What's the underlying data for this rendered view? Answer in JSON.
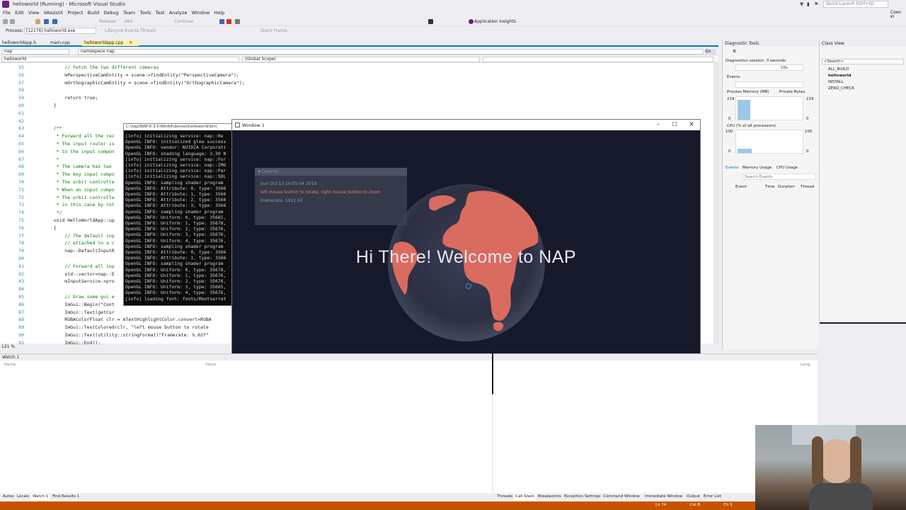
{
  "titlebar": {
    "title": "helloworld (Running) - Microsoft Visual Studio",
    "quick_launch": "Quick Launch (Ctrl+Q)",
    "user": "Coen Kl"
  },
  "menu": [
    "File",
    "Edit",
    "View",
    "VAssistX",
    "Project",
    "Build",
    "Debug",
    "Team",
    "Tools",
    "Test",
    "Analyze",
    "Window",
    "Help"
  ],
  "toolbar": {
    "config": "Release",
    "platform": "x64",
    "continue": "Continue",
    "insights": "Application Insights",
    "process_label": "Process:",
    "process_value": "[12176] helloworld.exe",
    "lifecycle": "Lifecycle Events",
    "thread": "Thread:",
    "stack_frame": "Stack Frame:"
  },
  "doc_tabs": [
    "helloworldapp.h",
    "main.cpp",
    "helloworldapp.cpp"
  ],
  "nav": {
    "project": "nap",
    "scope": "namespace nap",
    "file": "helloworld",
    "global": "(Global Scope)"
  },
  "editor": {
    "zoom": "121 %",
    "lines": [
      {
        "n": "55",
        "t": "        // Fetch the two different cameras",
        "c": "cm"
      },
      {
        "n": "56",
        "t": "        mPerspectiveCamEntity = scene->findEntity(\"PerspectiveCamera\");",
        "c": ""
      },
      {
        "n": "57",
        "t": "        mOrthographicCamEntity = scene->findEntity(\"OrthographicCamera\");",
        "c": ""
      },
      {
        "n": "58",
        "t": "",
        "c": ""
      },
      {
        "n": "59",
        "t": "        return true;",
        "c": ""
      },
      {
        "n": "60",
        "t": "    }",
        "c": ""
      },
      {
        "n": "61",
        "t": "",
        "c": ""
      },
      {
        "n": "62",
        "t": "",
        "c": ""
      },
      {
        "n": "63",
        "t": "    /**",
        "c": "cm"
      },
      {
        "n": "64",
        "t": "     * Forward all the rec",
        "c": "cm"
      },
      {
        "n": "65",
        "t": "     * The input router is",
        "c": "cm"
      },
      {
        "n": "66",
        "t": "     * to the input compon",
        "c": "cm"
      },
      {
        "n": "67",
        "t": "     *",
        "c": "cm"
      },
      {
        "n": "68",
        "t": "     * The camera has two",
        "c": "cm"
      },
      {
        "n": "69",
        "t": "     * The key input compo",
        "c": "cm"
      },
      {
        "n": "70",
        "t": "     * The orbit controlle",
        "c": "cm"
      },
      {
        "n": "71",
        "t": "     * When an input compo",
        "c": "cm"
      },
      {
        "n": "72",
        "t": "     * The orbit controlle",
        "c": "cm"
      },
      {
        "n": "73",
        "t": "     * in this case by rot",
        "c": "cm"
      },
      {
        "n": "74",
        "t": "     */",
        "c": "cm"
      },
      {
        "n": "75",
        "t": "    void HelloWorldApp::up",
        "c": ""
      },
      {
        "n": "76",
        "t": "    {",
        "c": ""
      },
      {
        "n": "77",
        "t": "        // The default inp",
        "c": "cm"
      },
      {
        "n": "78",
        "t": "        // attached to a c",
        "c": "cm"
      },
      {
        "n": "79",
        "t": "        nap::DefaultInputR",
        "c": ""
      },
      {
        "n": "80",
        "t": "",
        "c": ""
      },
      {
        "n": "81",
        "t": "        // Forward all inp",
        "c": "cm"
      },
      {
        "n": "82",
        "t": "        std::vector<nap::E",
        "c": ""
      },
      {
        "n": "83",
        "t": "        mInputService->pro",
        "c": ""
      },
      {
        "n": "84",
        "t": "",
        "c": ""
      },
      {
        "n": "85",
        "t": "        // Draw some gui e",
        "c": "cm"
      },
      {
        "n": "86",
        "t": "        ImGui::Begin(\"Cont",
        "c": ""
      },
      {
        "n": "87",
        "t": "        ImGui::Text(getCur",
        "c": ""
      },
      {
        "n": "88",
        "t": "        RGBAColorFloat clr = mTextHighlightColor.convert<RGBA",
        "c": ""
      },
      {
        "n": "89",
        "t": "        ImGui::TextColored(clr, \"left mouse button to rotate",
        "c": ""
      },
      {
        "n": "90",
        "t": "        ImGui::Text(utility::stringFormat(\"Framerate: %.02f\"",
        "c": ""
      },
      {
        "n": "91",
        "t": "        ImGui::End();",
        "c": ""
      }
    ]
  },
  "console": {
    "title": "C:\\nap\\NAP-0.3.0-Win64\\demos\\helloworld\\bin\\",
    "lines": [
      "[info] initializing service: nap::Re",
      "OpenGL INFO: initialized glew success",
      "OpenGL INFO: vendor: NVIDIA Corporati",
      "OpenGL INFO: shading language: 3.30 N",
      "[info] initializing service: nap::For",
      "[info] initializing service: nap::IMG",
      "[info] initializing service: nap::Par",
      "[info] initializing service: nap::SDL",
      "OpenGL INFO: sampling shader program",
      "OpenGL INFO: Attribute: 0, type: 3566",
      "OpenGL INFO: Attribute: 1, type: 3566",
      "OpenGL INFO: Attribute: 2, type: 3566",
      "OpenGL INFO: Attribute: 3, type: 3566",
      "OpenGL INFO: sampling shader program",
      "OpenGL INFO: Uniform: 0, type: 35665,",
      "OpenGL INFO: Uniform: 1, type: 35678,",
      "OpenGL INFO: Uniform: 2, type: 35676,",
      "OpenGL INFO: Uniform: 3, type: 35676,",
      "OpenGL INFO: Uniform: 4, type: 35676,",
      "OpenGL INFO: sampling shader program",
      "OpenGL INFO: Attribute: 0, type: 3566",
      "OpenGL INFO: Attribute: 1, type: 3566",
      "OpenGL INFO: sampling shader program",
      "OpenGL INFO: Uniform: 0, type: 35678,",
      "OpenGL INFO: Uniform: 1, type: 35676,",
      "OpenGL INFO: Uniform: 2, type: 35676,",
      "OpenGL INFO: Uniform: 3, type: 35665,",
      "OpenGL INFO: Uniform: 4, type: 35676,",
      "[info] loading font: fonts/Montserrat"
    ]
  },
  "app_window": {
    "title": "Window 1",
    "controls_header": "Controls",
    "date": "Sun Oct 13 16:05:04 2019",
    "hint": "left mouse button to rotate, right mouse button to zoom",
    "framerate": "Framerate: 1912.67",
    "welcome": "Hi There! Welcome to NAP",
    "colors": {
      "background": "#16192a",
      "land": "#d96b5f",
      "ocean": "#2c2f42",
      "highlight": "#e57a6f"
    }
  },
  "diagnostics": {
    "title": "Diagnostic Tools",
    "session": "Diagnostics session: 3 seconds",
    "timeline_label": "10s",
    "events_label": "Events",
    "memory_label": "Process Memory (MB)",
    "private_bytes": "Private Bytes",
    "mem_max": "219",
    "mem_min": "0",
    "cpu_label": "CPU (% of all processors)",
    "cpu_max": "100",
    "cpu_min": "0",
    "tabs": [
      "Events",
      "Memory Usage",
      "CPU Usage"
    ],
    "search": "Search Events",
    "columns": [
      "Event",
      "Time",
      "Duration",
      "Thread"
    ]
  },
  "class_view": {
    "title": "Class View",
    "search": "<Search>",
    "items": [
      "ALL_BUILD",
      "helloworld",
      "INSTALL",
      "ZERO_CHECK"
    ]
  },
  "watch": {
    "title": "Watch 1",
    "columns": [
      "Name",
      "Value"
    ],
    "lang": "Lang"
  },
  "bottom_tabs_left": [
    "Autos",
    "Locals",
    "Watch 1",
    "Find Results 1"
  ],
  "bottom_tabs_right": [
    "Threads",
    "Call Stack",
    "Breakpoints",
    "Exception Settings",
    "Command Window",
    "Immediate Window",
    "Output",
    "Error List"
  ],
  "status": {
    "ln": "Ln 74",
    "col": "Col 8",
    "ch": "Ch 5"
  }
}
